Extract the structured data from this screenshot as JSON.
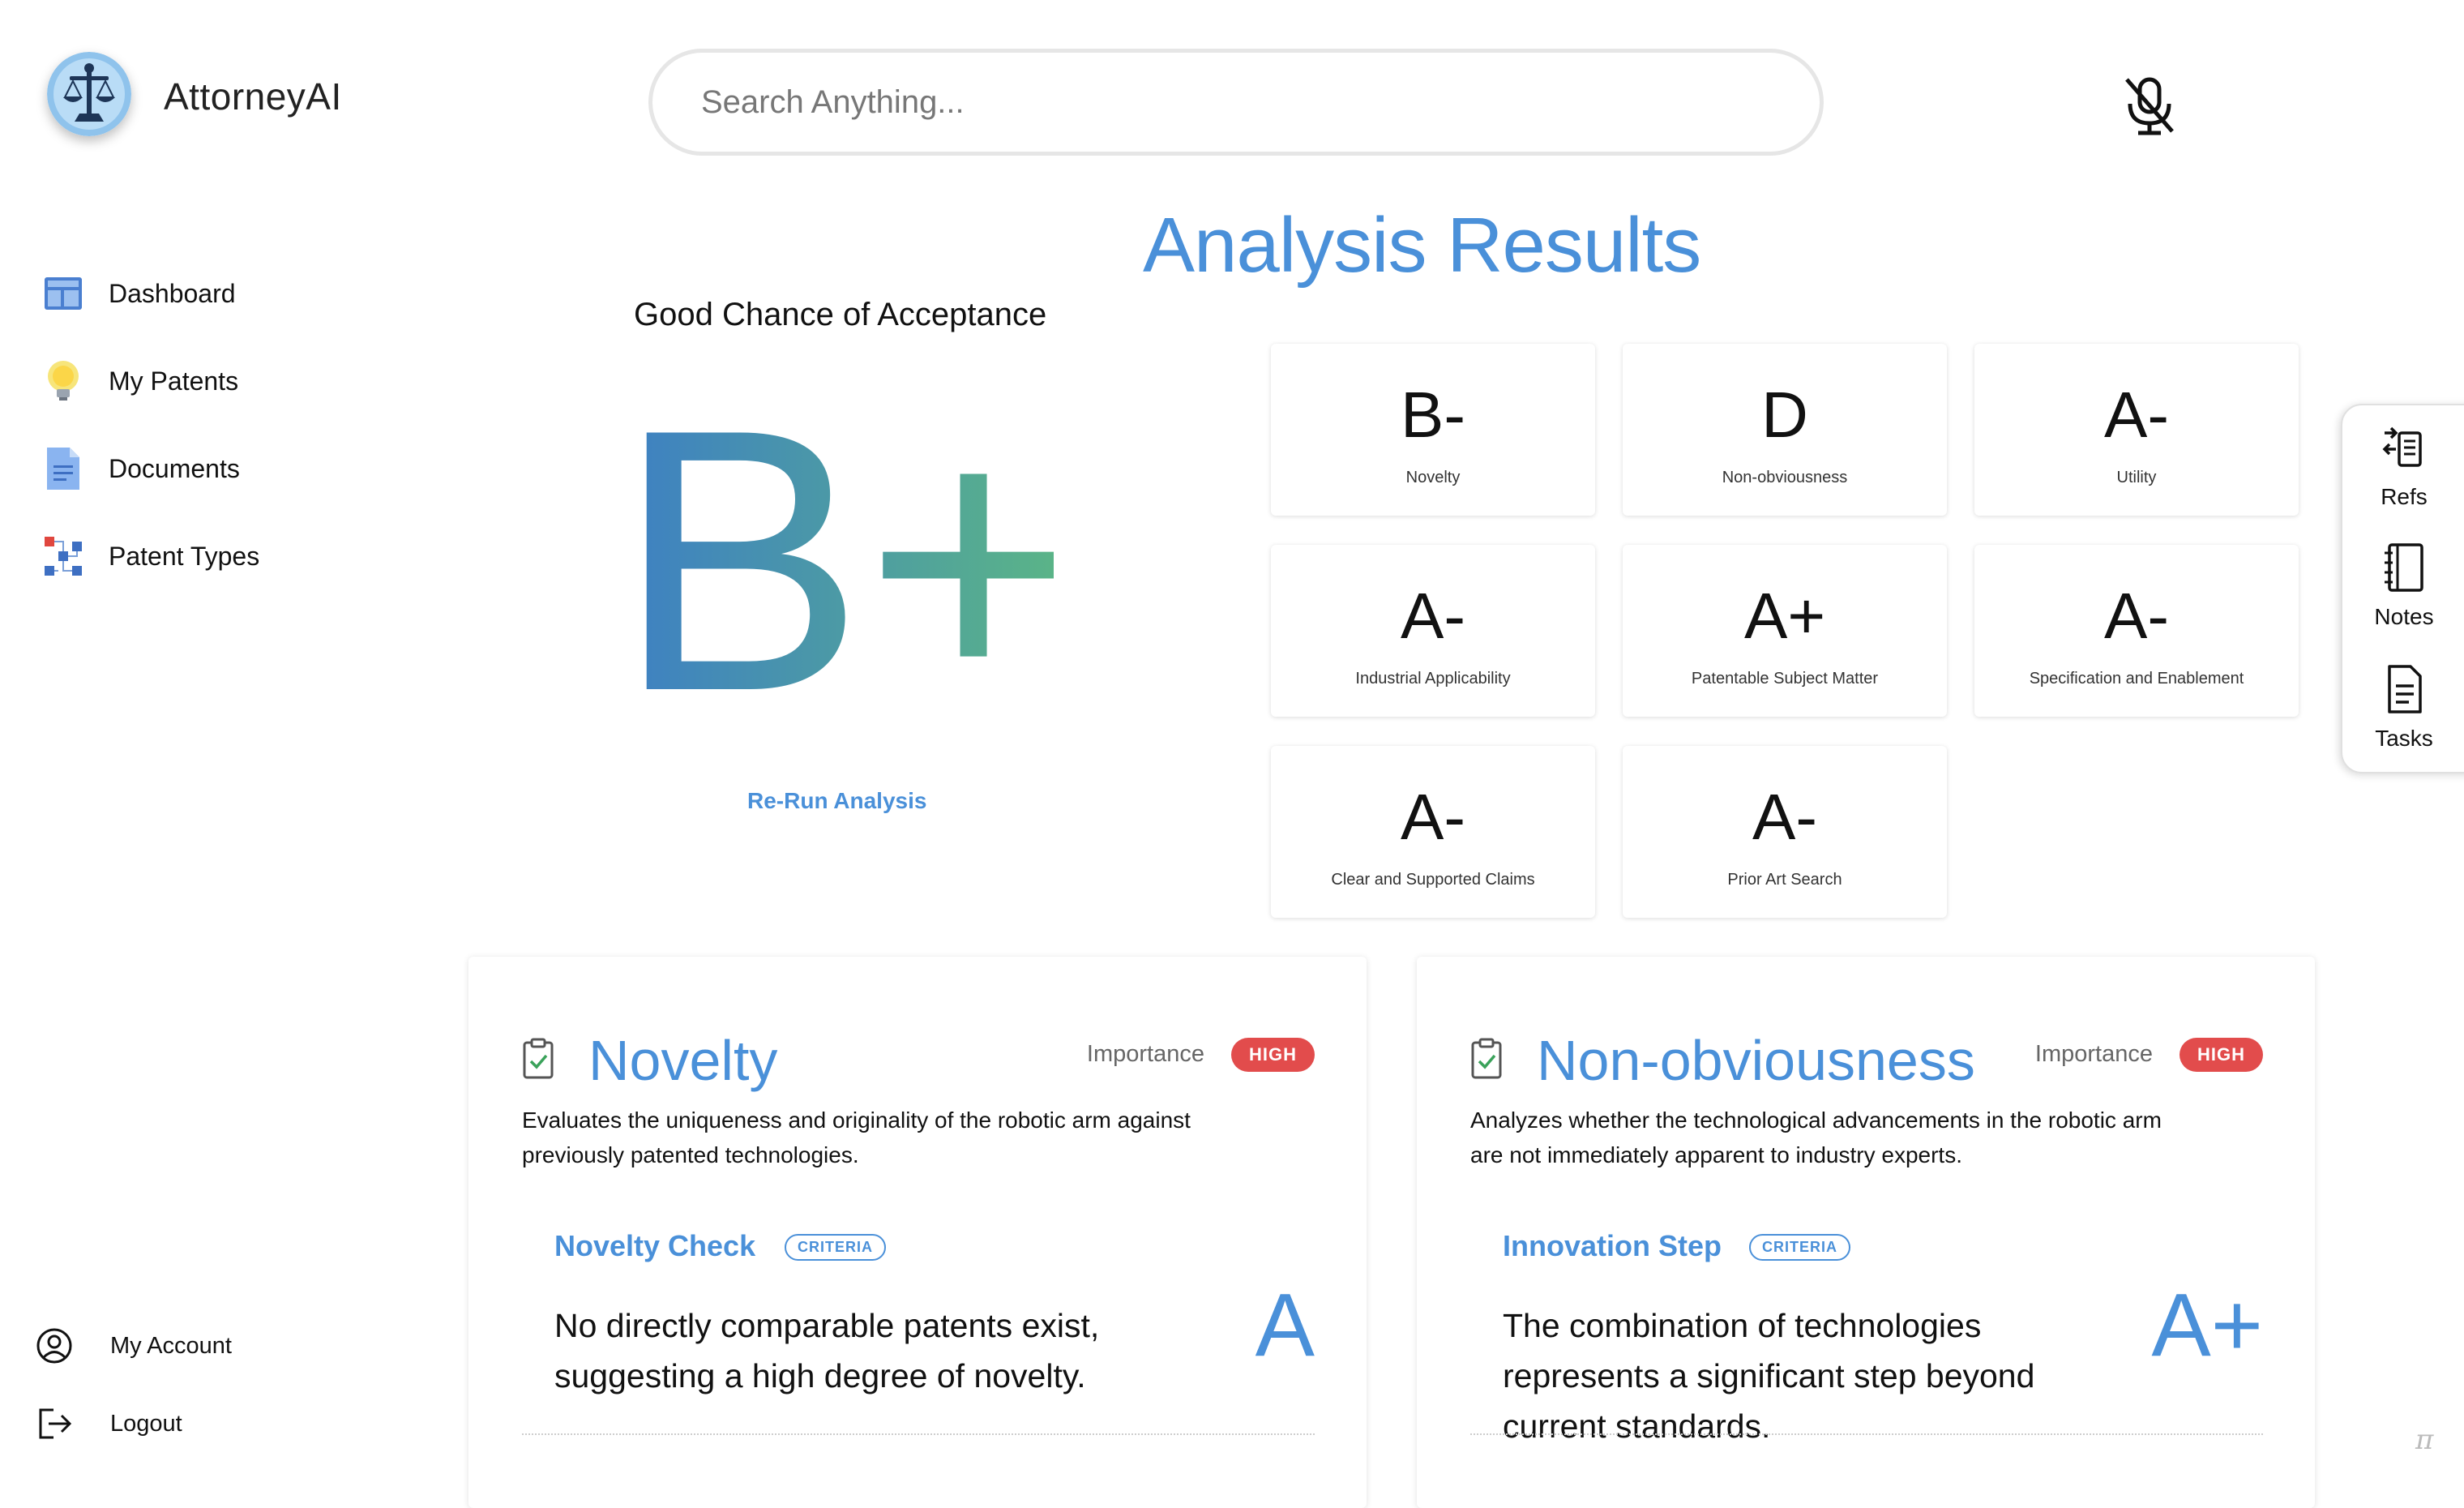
{
  "app": {
    "brand": "AttorneyAI"
  },
  "search": {
    "placeholder": "Search Anything..."
  },
  "sidebar": {
    "items": [
      {
        "label": "Dashboard"
      },
      {
        "label": "My Patents"
      },
      {
        "label": "Documents"
      },
      {
        "label": "Patent Types"
      }
    ],
    "bottom": [
      {
        "label": "My Account"
      },
      {
        "label": "Logout"
      }
    ]
  },
  "main": {
    "title": "Analysis Results",
    "overall": {
      "subtitle": "Good Chance of Acceptance",
      "grade": "B+",
      "rerun": "Re-Run Analysis",
      "gradient_start": "#3d7fc4",
      "gradient_end": "#5cb784"
    },
    "cards": [
      {
        "grade": "B-",
        "label": "Novelty"
      },
      {
        "grade": "D",
        "label": "Non-obviousness"
      },
      {
        "grade": "A-",
        "label": "Utility"
      },
      {
        "grade": "A-",
        "label": "Industrial Applicability"
      },
      {
        "grade": "A+",
        "label": "Patentable Subject Matter"
      },
      {
        "grade": "A-",
        "label": "Specification and Enablement"
      },
      {
        "grade": "A-",
        "label": "Clear and Supported Claims"
      },
      {
        "grade": "A-",
        "label": "Prior Art Search"
      }
    ],
    "details": [
      {
        "title": "Novelty",
        "importance_label": "Importance",
        "importance": "HIGH",
        "description": "Evaluates the uniqueness and originality of the robotic arm against previously patented technologies.",
        "criterion_title": "Novelty Check",
        "criterion_tag": "CRITERIA",
        "criterion_text": "No directly comparable patents exist, suggesting a high degree of novelty.",
        "criterion_grade": "A"
      },
      {
        "title": "Non-obviousness",
        "importance_label": "Importance",
        "importance": "HIGH",
        "description": "Analyzes whether the technological advancements in the robotic arm are not immediately apparent to industry experts.",
        "criterion_title": "Innovation Step",
        "criterion_tag": "CRITERIA",
        "criterion_text": "The combination of technologies represents a significant step beyond current standards.",
        "criterion_grade": "A+"
      }
    ]
  },
  "rail": {
    "items": [
      {
        "label": "Refs",
        "icon": "refs-icon"
      },
      {
        "label": "Notes",
        "icon": "notebook-icon"
      },
      {
        "label": "Tasks",
        "icon": "document-icon"
      }
    ]
  },
  "footer": {
    "symbol": "π"
  },
  "colors": {
    "accent": "#4a90d9",
    "badge": "#e24c4c"
  }
}
